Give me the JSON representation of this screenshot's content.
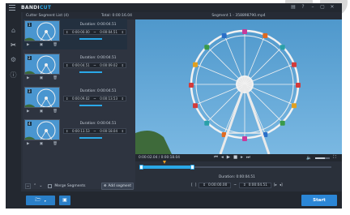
{
  "app": {
    "logo_main": "BANDI",
    "logo_accent": "CUT"
  },
  "titlebar_icons": [
    "folder-icon",
    "help-icon",
    "minimize-icon",
    "restore-icon",
    "close-icon"
  ],
  "segment_list": {
    "title": "Cutter Segment List (4)",
    "total": "Total: 0:00:16.04",
    "segments": [
      {
        "num": "1",
        "duration": "Duration: 0:00:04.51",
        "start": "0:00:00.00",
        "end": "0:00:04.51"
      },
      {
        "num": "2",
        "duration": "Duration: 0:00:04.51",
        "start": "0:00:04.51",
        "end": "0:00:09.02"
      },
      {
        "num": "3",
        "duration": "Duration: 0:00:04.51",
        "start": "0:00:09.02",
        "end": "0:00:13.53"
      },
      {
        "num": "4",
        "duration": "Duration: 0:00:04.51",
        "start": "0:00:13.53",
        "end": "0:00:18.04"
      }
    ],
    "merge_label": "Merge Segments",
    "add_label": "Add segment"
  },
  "player": {
    "title": "Segment 1 - 358898790.mp4",
    "time": "0:00:02.04 / 0:00:18.04",
    "duration": "Duration: 0:00:04.51",
    "range_start": "0:00:00.00",
    "range_end": "0:00:04.51"
  },
  "bottom": {
    "start_label": "Start"
  },
  "colors": {
    "accent": "#2aa8e8",
    "button": "#2a7fc8",
    "background": "#2a303a"
  }
}
